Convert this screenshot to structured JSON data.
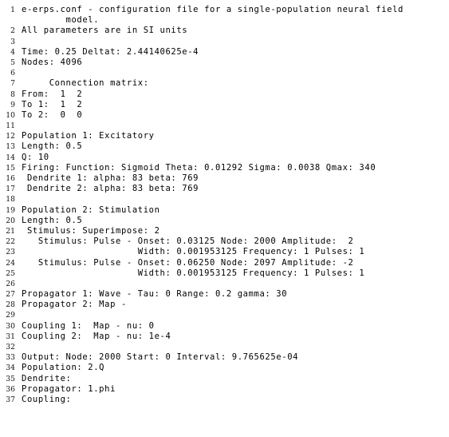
{
  "document": {
    "kind": "source-code-listing",
    "filename": "e-erps.conf",
    "background_color": "#ffffff",
    "text_color": "#000000",
    "line_number_color": "#111111",
    "total_numbered_lines": 37
  },
  "lines": [
    {
      "no": "1",
      "text": "e-erps.conf - configuration file for a single-population neural field"
    },
    {
      "no": "",
      "text": "        model.",
      "wrapped": true
    },
    {
      "no": "2",
      "text": "All parameters are in SI units"
    },
    {
      "no": "3",
      "text": ""
    },
    {
      "no": "4",
      "text": "Time: 0.25 Deltat: 2.44140625e-4"
    },
    {
      "no": "5",
      "text": "Nodes: 4096"
    },
    {
      "no": "6",
      "text": ""
    },
    {
      "no": "7",
      "text": "     Connection matrix:"
    },
    {
      "no": "8",
      "text": "From:  1  2"
    },
    {
      "no": "9",
      "text": "To 1:  1  2"
    },
    {
      "no": "10",
      "text": "To 2:  0  0"
    },
    {
      "no": "11",
      "text": ""
    },
    {
      "no": "12",
      "text": "Population 1: Excitatory"
    },
    {
      "no": "13",
      "text": "Length: 0.5"
    },
    {
      "no": "14",
      "text": "Q: 10"
    },
    {
      "no": "15",
      "text": "Firing: Function: Sigmoid Theta: 0.01292 Sigma: 0.0038 Qmax: 340"
    },
    {
      "no": "16",
      "text": " Dendrite 1: alpha: 83 beta: 769"
    },
    {
      "no": "17",
      "text": " Dendrite 2: alpha: 83 beta: 769"
    },
    {
      "no": "18",
      "text": ""
    },
    {
      "no": "19",
      "text": "Population 2: Stimulation"
    },
    {
      "no": "20",
      "text": "Length: 0.5"
    },
    {
      "no": "21",
      "text": " Stimulus: Superimpose: 2"
    },
    {
      "no": "22",
      "text": "   Stimulus: Pulse - Onset: 0.03125 Node: 2000 Amplitude:  2"
    },
    {
      "no": "23",
      "text": "                     Width: 0.001953125 Frequency: 1 Pulses: 1"
    },
    {
      "no": "24",
      "text": "   Stimulus: Pulse - Onset: 0.06250 Node: 2097 Amplitude: -2"
    },
    {
      "no": "25",
      "text": "                     Width: 0.001953125 Frequency: 1 Pulses: 1"
    },
    {
      "no": "26",
      "text": ""
    },
    {
      "no": "27",
      "text": "Propagator 1: Wave - Tau: 0 Range: 0.2 gamma: 30"
    },
    {
      "no": "28",
      "text": "Propagator 2: Map -"
    },
    {
      "no": "29",
      "text": ""
    },
    {
      "no": "30",
      "text": "Coupling 1:  Map - nu: 0"
    },
    {
      "no": "31",
      "text": "Coupling 2:  Map - nu: 1e-4"
    },
    {
      "no": "32",
      "text": ""
    },
    {
      "no": "33",
      "text": "Output: Node: 2000 Start: 0 Interval: 9.765625e-04"
    },
    {
      "no": "34",
      "text": "Population: 2.Q"
    },
    {
      "no": "35",
      "text": "Dendrite:"
    },
    {
      "no": "36",
      "text": "Propagator: 1.phi"
    },
    {
      "no": "37",
      "text": "Coupling:"
    }
  ]
}
